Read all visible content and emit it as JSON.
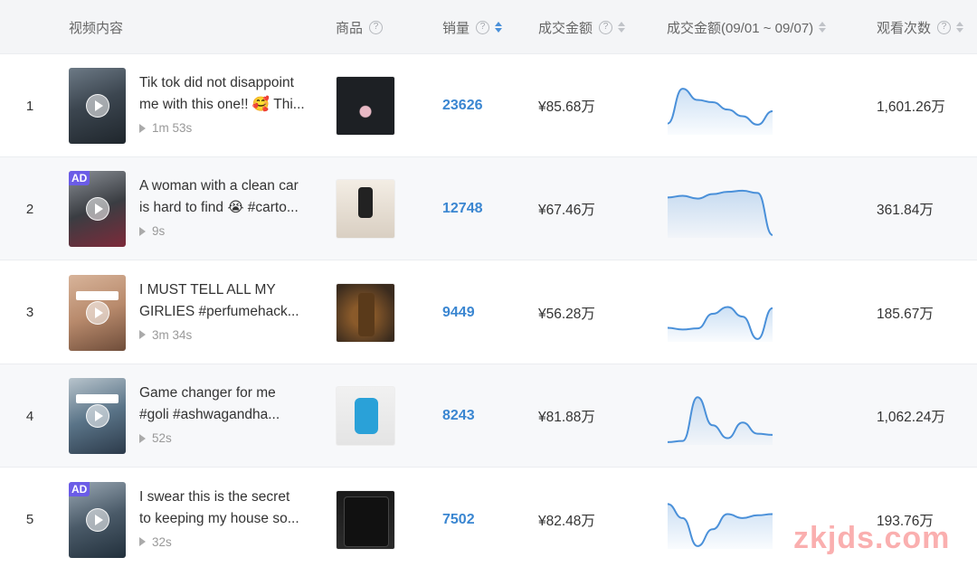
{
  "header": {
    "video": "视频内容",
    "product": "商品",
    "sales": "销量",
    "amount": "成交金额",
    "amount_range": "成交金额(09/01 ~ 09/07)",
    "views": "观看次数"
  },
  "rows": [
    {
      "rank": "1",
      "title_line1": "Tik tok did not disappoint",
      "title_line2": "me with this one!! 🥰 Thi...",
      "duration": "1m 53s",
      "ad": "",
      "sales": "23626",
      "amount": "¥85.68万",
      "views": "1,601.26万",
      "trend": [
        0.2,
        0.82,
        0.62,
        0.58,
        0.45,
        0.33,
        0.18,
        0.42
      ]
    },
    {
      "rank": "2",
      "title_line1": "A woman with a clean car",
      "title_line2": "is hard to find 😭 #carto...",
      "duration": "9s",
      "ad": "AD",
      "sales": "12748",
      "amount": "¥67.46万",
      "views": "361.84万",
      "trend": [
        0.72,
        0.75,
        0.7,
        0.78,
        0.82,
        0.84,
        0.8,
        0.05
      ]
    },
    {
      "rank": "3",
      "title_line1": "I MUST TELL ALL MY",
      "title_line2": "GIRLIES #perfumehack...",
      "duration": "3m 34s",
      "ad": "",
      "sales": "9449",
      "amount": "¥56.28万",
      "views": "185.67万",
      "trend": [
        0.25,
        0.22,
        0.24,
        0.5,
        0.62,
        0.45,
        0.05,
        0.6
      ]
    },
    {
      "rank": "4",
      "title_line1": "Game changer for me",
      "title_line2": "#goli #ashwagandha...",
      "duration": "52s",
      "ad": "",
      "sales": "8243",
      "amount": "¥81.88万",
      "views": "1,062.24万",
      "trend": [
        0.05,
        0.07,
        0.85,
        0.35,
        0.12,
        0.4,
        0.2,
        0.18
      ]
    },
    {
      "rank": "5",
      "title_line1": "I swear this is the secret",
      "title_line2": "to keeping my house so...",
      "duration": "32s",
      "ad": "AD",
      "sales": "7502",
      "amount": "¥82.48万",
      "views": "193.76万",
      "trend": [
        0.8,
        0.55,
        0.05,
        0.35,
        0.62,
        0.55,
        0.6,
        0.62
      ]
    }
  ],
  "watermark": "zkjds.com",
  "colors": {
    "accent": "#3a86d1",
    "spark_line": "#4a90d9",
    "header_bg": "#f4f5f7",
    "alt_row_bg": "#f7f8fa"
  }
}
